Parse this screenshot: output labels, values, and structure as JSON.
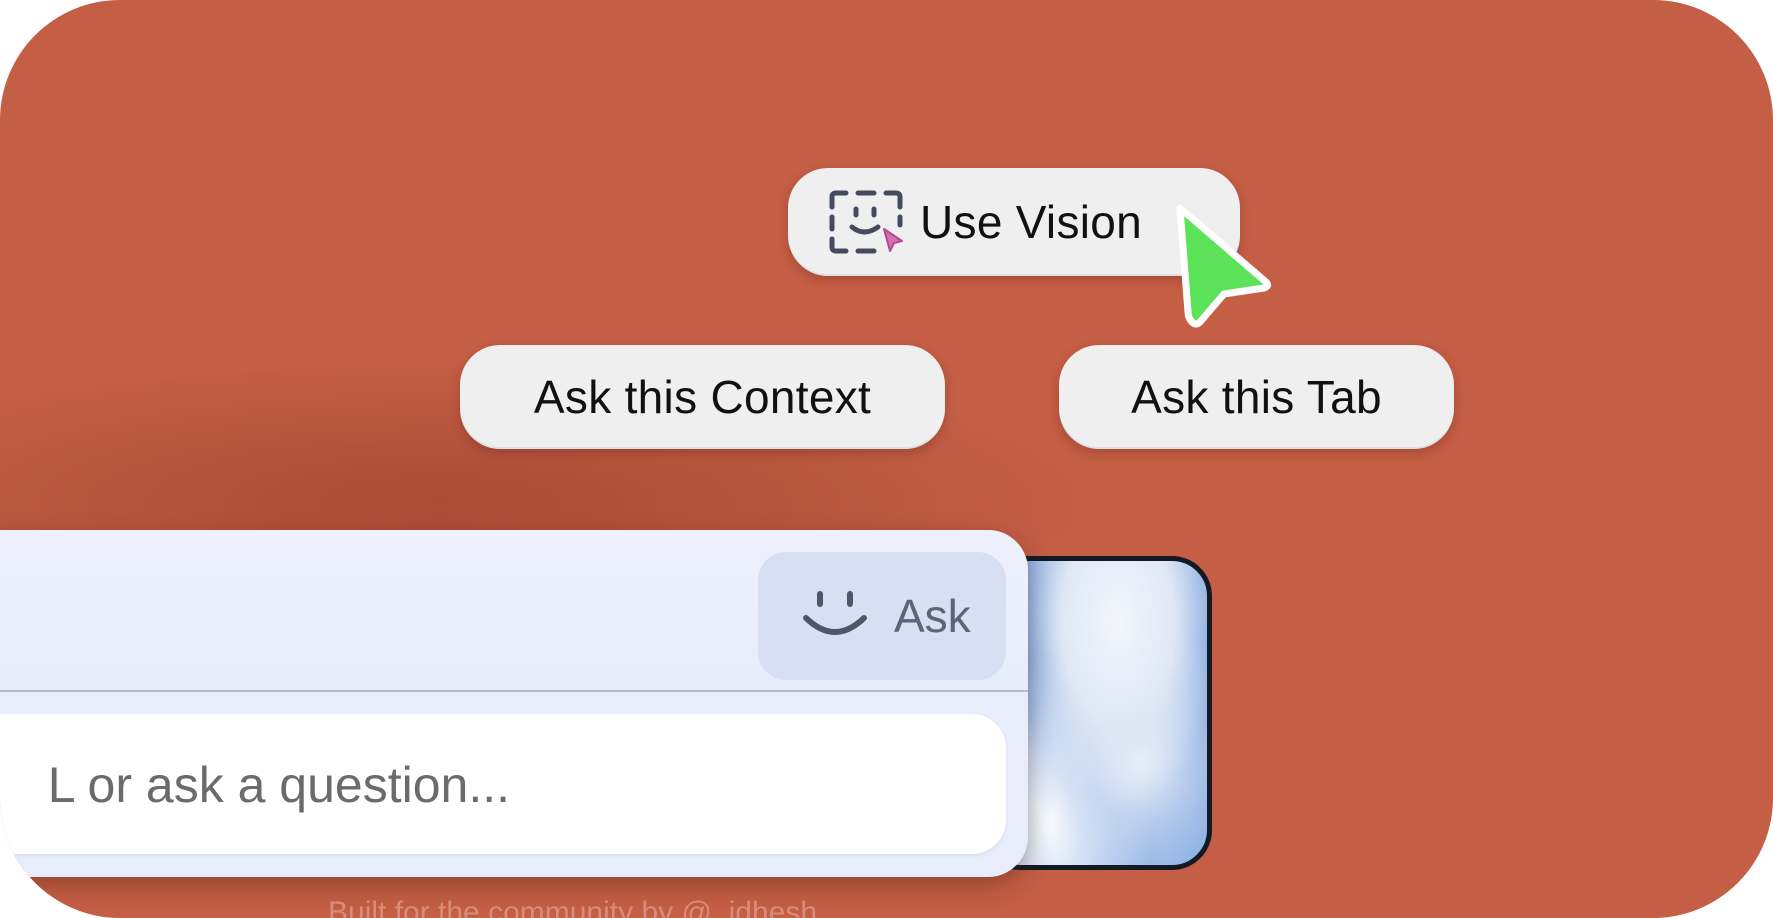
{
  "actions": {
    "use_vision_label": "Use Vision",
    "ask_context_label": "Ask this Context",
    "ask_tab_label": "Ask this Tab"
  },
  "input_panel": {
    "ask_label": "Ask",
    "input_visible_text": "L or ask a question...",
    "input_icon": "smile-icon"
  },
  "icons": {
    "vision": "vision-scan-icon",
    "cursor": "mouse-cursor-icon"
  },
  "footer": {
    "credit": "Built for the community by @_idhesh"
  },
  "colors": {
    "background": "#c45e45",
    "pill": "#f0eff0",
    "cursor": "#5de35a",
    "panel": "#e7edfb",
    "ask_button": "#d7e0f3"
  }
}
